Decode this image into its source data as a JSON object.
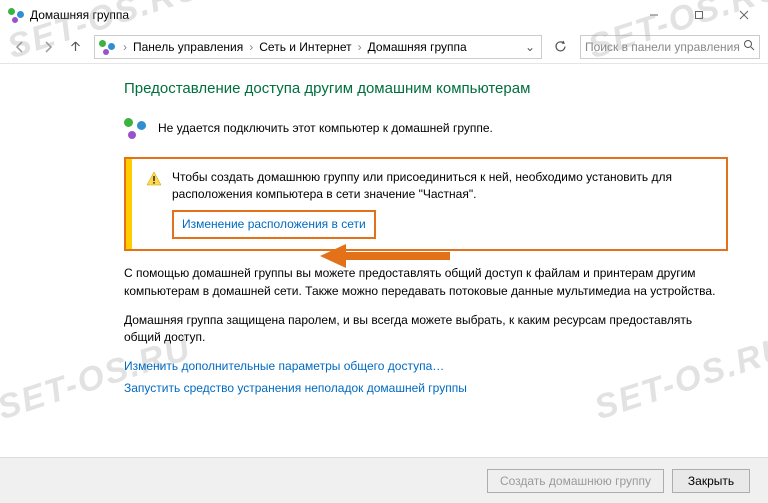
{
  "titlebar": {
    "title": "Домашняя группа"
  },
  "breadcrumb": {
    "items": [
      "Панель управления",
      "Сеть и Интернет",
      "Домашняя группа"
    ]
  },
  "search": {
    "placeholder": "Поиск в панели управления"
  },
  "heading": "Предоставление доступа другим домашним компьютерам",
  "status": "Не удается подключить этот компьютер к домашней группе.",
  "infobox": {
    "text": "Чтобы создать домашнюю группу или присоединиться к ней, необходимо установить для расположения компьютера в сети значение \"Частная\".",
    "link": "Изменение расположения в сети"
  },
  "para1": "С помощью домашней группы вы можете предоставлять общий доступ к файлам и принтерам другим компьютерам в домашней сети. Также можно передавать потоковые данные мультимедиа на устройства.",
  "para2": "Домашняя группа защищена паролем, и вы всегда можете выбрать, к каким ресурсам предоставлять общий доступ.",
  "links": {
    "l1": "Изменить дополнительные параметры общего доступа…",
    "l2": "Запустить средство устранения неполадок домашней группы"
  },
  "footer": {
    "create": "Создать домашнюю группу",
    "close": "Закрыть"
  },
  "watermark": "SET-OS.RU"
}
